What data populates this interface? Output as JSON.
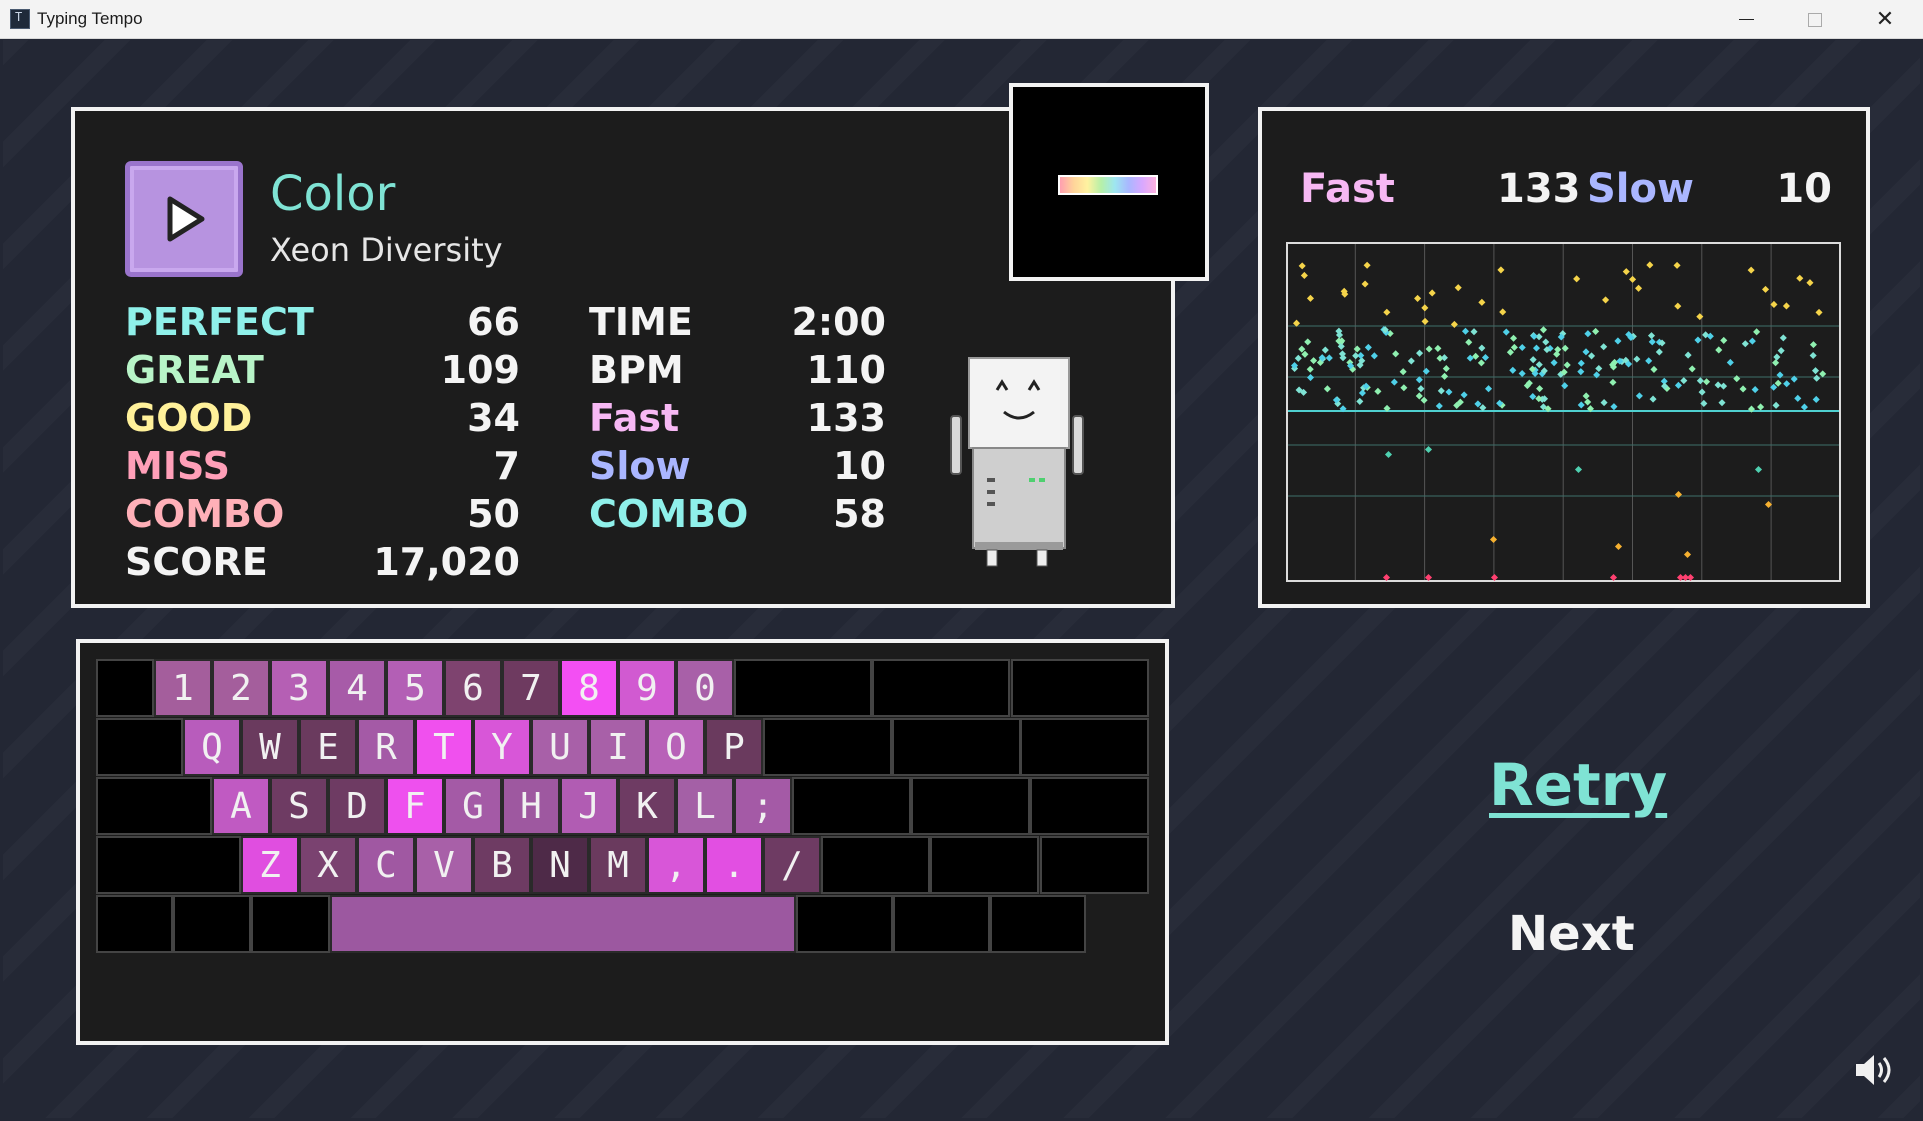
{
  "window": {
    "title": "Typing Tempo"
  },
  "song": {
    "title": "Color",
    "artist": "Xeon Diversity"
  },
  "stats_left": [
    {
      "label": "PERFECT",
      "value": "66",
      "color": "#8ff0ea"
    },
    {
      "label": "GREAT",
      "value": "109",
      "color": "#b8f4c8"
    },
    {
      "label": "GOOD",
      "value": "34",
      "color": "#fff19a"
    },
    {
      "label": "MISS",
      "value": "7",
      "color": "#ff9fb8"
    },
    {
      "label": "COMBO",
      "value": "50",
      "color": "#ffb0b8"
    },
    {
      "label": "SCORE",
      "value": "17,020",
      "color": "#f4f4f4"
    }
  ],
  "stats_right": [
    {
      "label": "TIME",
      "value": "2:00",
      "color": "#f4f4f4"
    },
    {
      "label": "BPM",
      "value": "110",
      "color": "#f4f4f4"
    },
    {
      "label": "Fast",
      "value": "133",
      "color": "#f7b8f4"
    },
    {
      "label": "Slow",
      "value": "10",
      "color": "#aab6ff"
    },
    {
      "label": "COMBO",
      "value": "58",
      "color": "#8ff0ea"
    }
  ],
  "graph": {
    "fast_label": "Fast",
    "fast_value": "133",
    "slow_label": "Slow",
    "slow_value": "10"
  },
  "keyboard": {
    "rows": [
      {
        "keys": [
          [
            "1",
            "#a45e9c"
          ],
          [
            "2",
            "#a45e9c"
          ],
          [
            "3",
            "#b55fb4"
          ],
          [
            "4",
            "#a75ba8"
          ],
          [
            "5",
            "#b35fb5"
          ],
          [
            "6",
            "#7e436f"
          ],
          [
            "7",
            "#6e3a60"
          ],
          [
            "8",
            "#f34ff3"
          ],
          [
            "9",
            "#d15ad1"
          ],
          [
            "0",
            "#a860a8"
          ]
        ]
      },
      {
        "keys": [
          [
            "Q",
            "#b85cbc"
          ],
          [
            "W",
            "#6a3a5e"
          ],
          [
            "E",
            "#6a3a5e"
          ],
          [
            "R",
            "#a45aa6"
          ],
          [
            "T",
            "#f050ee"
          ],
          [
            "Y",
            "#d856d8"
          ],
          [
            "U",
            "#a860a8"
          ],
          [
            "I",
            "#a860a8"
          ],
          [
            "O",
            "#b862b8"
          ],
          [
            "P",
            "#6a3a5e"
          ]
        ]
      },
      {
        "keys": [
          [
            "A",
            "#c05ac2"
          ],
          [
            "S",
            "#6e3b63"
          ],
          [
            "D",
            "#6e3b63"
          ],
          [
            "F",
            "#ee50ee"
          ],
          [
            "G",
            "#a45aa6"
          ],
          [
            "H",
            "#9e58a0"
          ],
          [
            "J",
            "#b15cb3"
          ],
          [
            "K",
            "#6e3b63"
          ],
          [
            "L",
            "#a460a6"
          ],
          [
            ";",
            "#a45aa6"
          ]
        ]
      },
      {
        "keys": [
          [
            "Z",
            "#e04ee0"
          ],
          [
            "X",
            "#7a4270"
          ],
          [
            "C",
            "#a058a2"
          ],
          [
            "V",
            "#a860a8"
          ],
          [
            "B",
            "#6e3b63"
          ],
          [
            "N",
            "#4e2a48"
          ],
          [
            "M",
            "#6a3a5e"
          ],
          [
            ",",
            "#d856d8"
          ],
          [
            ".",
            "#e24fe2"
          ],
          [
            "/",
            "#6e3b63"
          ]
        ]
      }
    ],
    "space_color": "#9c58a0"
  },
  "actions": {
    "retry": "Retry",
    "next": "Next"
  },
  "icons": {
    "play": "play-icon",
    "speaker": "speaker-icon",
    "robot": "robot-mascot"
  }
}
